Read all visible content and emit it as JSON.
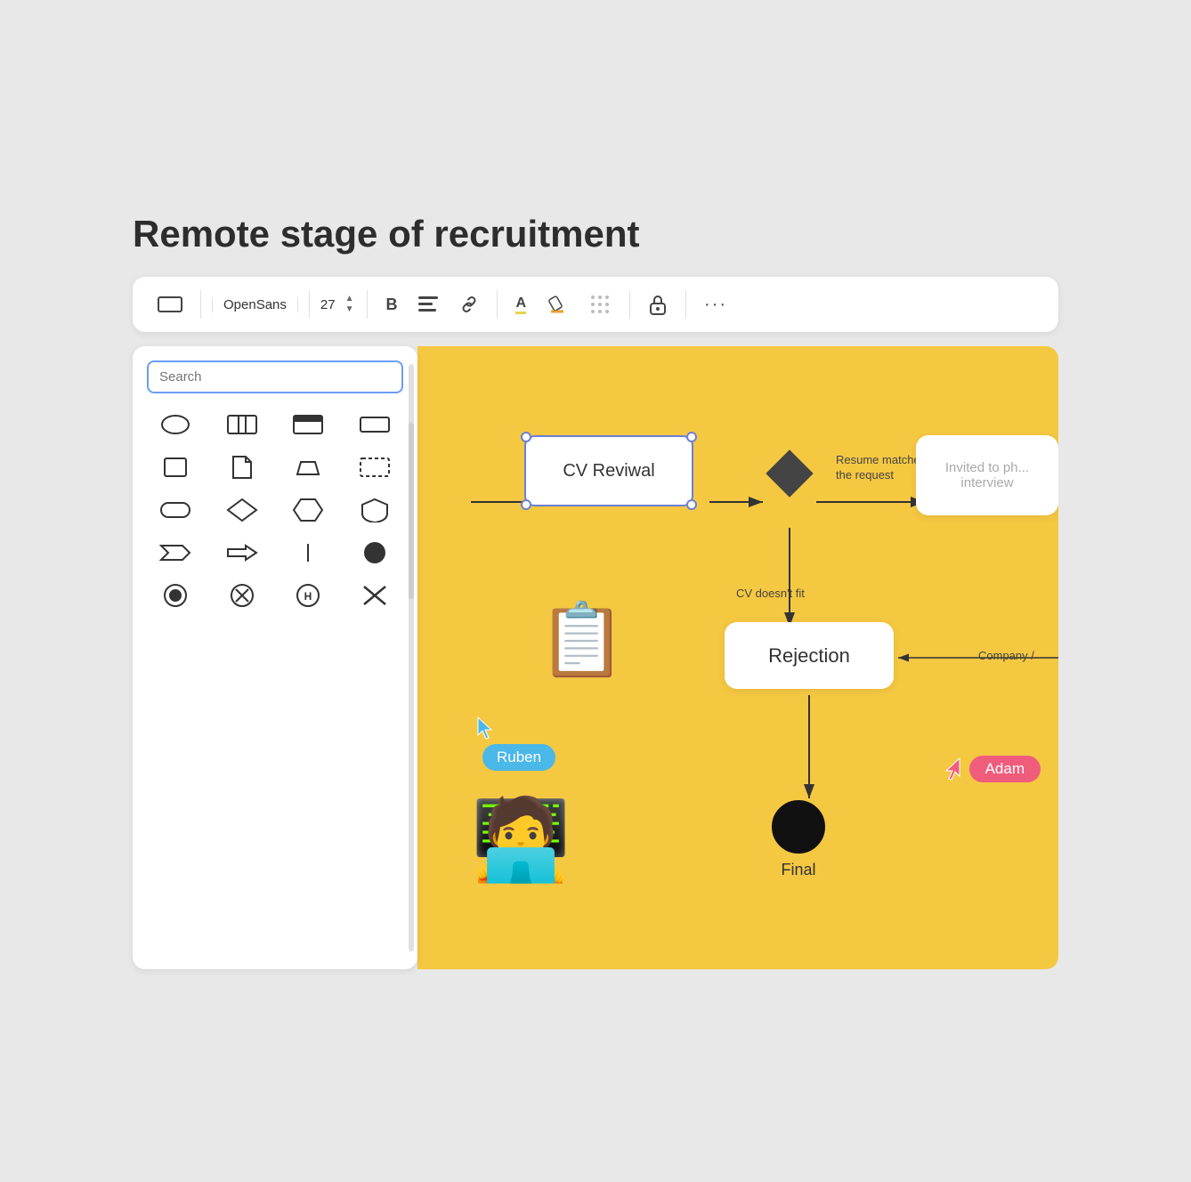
{
  "page": {
    "title": "Remote stage of recruitment"
  },
  "toolbar": {
    "shape_icon_label": "rectangle shape",
    "font_name": "OpenSans",
    "font_size": "27",
    "bold_label": "B",
    "align_label": "≡",
    "link_label": "🔗",
    "font_color_label": "A",
    "highlight_label": "✏",
    "pattern_label": "⊞",
    "lock_label": "🔒",
    "more_label": "···"
  },
  "shapes_panel": {
    "search_placeholder": "Search",
    "shapes": [
      "ellipse",
      "columns",
      "card",
      "rectangle",
      "square",
      "doc",
      "trapezoid",
      "dashed-rect",
      "rounded-rect",
      "diamond",
      "hexagon",
      "shield",
      "chevron",
      "arrow-right",
      "line",
      "circle-filled",
      "circle-target",
      "circle-x",
      "circle-h",
      "x-mark"
    ]
  },
  "canvas": {
    "cv_revival_label": "CV Reviwal",
    "rejection_label": "Rejection",
    "final_label": "Final",
    "invited_label": "Invited to ph... interview",
    "resume_matches_label": "Resume matches the request",
    "cv_doesnt_fit_label": "CV doesn't fit",
    "company_label": "Company /",
    "cursor_ruben_label": "Ruben",
    "cursor_adam_label": "Adam"
  }
}
